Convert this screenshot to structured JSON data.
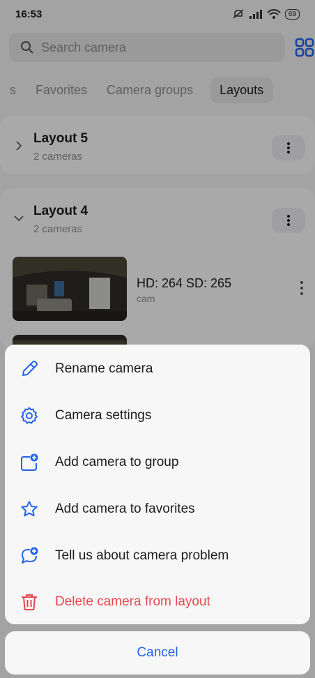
{
  "status": {
    "time": "16:53",
    "battery": "69"
  },
  "search": {
    "placeholder": "Search camera"
  },
  "tabs": [
    {
      "label": "s"
    },
    {
      "label": "Favorites"
    },
    {
      "label": "Camera groups"
    },
    {
      "label": "Layouts"
    }
  ],
  "layouts": [
    {
      "title": "Layout 5",
      "subtitle": "2 cameras",
      "expanded": false
    },
    {
      "title": "Layout 4",
      "subtitle": "2 cameras",
      "expanded": true
    }
  ],
  "camera": {
    "name": "HD: 264 SD: 265",
    "subtitle": "cam"
  },
  "actions": [
    {
      "label": "Rename camera",
      "icon": "pencil-icon"
    },
    {
      "label": "Camera settings",
      "icon": "gear-icon"
    },
    {
      "label": "Add camera to group",
      "icon": "folder-add-icon"
    },
    {
      "label": "Add camera to favorites",
      "icon": "star-icon"
    },
    {
      "label": "Tell us about camera problem",
      "icon": "chat-add-icon"
    },
    {
      "label": "Delete camera from layout",
      "icon": "trash-icon"
    }
  ],
  "cancel_label": "Cancel",
  "colors": {
    "accent": "#2463eb",
    "danger": "#e5484d"
  }
}
